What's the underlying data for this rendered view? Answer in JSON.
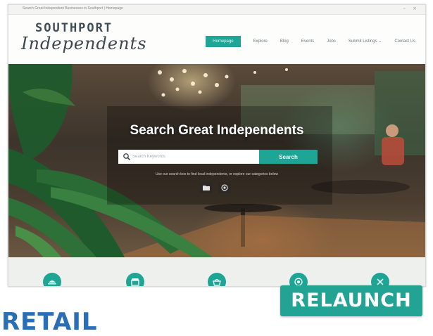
{
  "window": {
    "title": "Search Great Independent Businesses in Southport | Homepage",
    "minimize_glyph": "–",
    "close_glyph": "×"
  },
  "logo": {
    "line1": "SOUTHPORT",
    "line2": "Independents"
  },
  "nav": {
    "items": [
      {
        "label": "Homepage",
        "active": true
      },
      {
        "label": "Explore"
      },
      {
        "label": "Blog"
      },
      {
        "label": "Events"
      },
      {
        "label": "Jobs"
      },
      {
        "label": "Submit Listings ⌄"
      },
      {
        "label": "Contact Us"
      }
    ]
  },
  "hero": {
    "title": "Search Great Independents",
    "search": {
      "placeholder": "Search Keywords",
      "button_label": "Search"
    },
    "subtext": "Use our search box to find local independents, or explore our categories below",
    "buttons": [
      {
        "icon": "folder-icon"
      },
      {
        "icon": "target-icon"
      }
    ]
  },
  "categories": [
    {
      "icon": "food-icon"
    },
    {
      "icon": "shop-icon"
    },
    {
      "icon": "basket-icon"
    },
    {
      "icon": "health-icon"
    },
    {
      "icon": "tools-icon"
    }
  ],
  "overlay": {
    "badge_label": "RELAUNCH",
    "section_label": "RETAIL"
  },
  "colors": {
    "accent": "#1fa595",
    "badge": "#23a393",
    "retail_text": "#2a6fb5",
    "logo": "#3e4c55"
  }
}
